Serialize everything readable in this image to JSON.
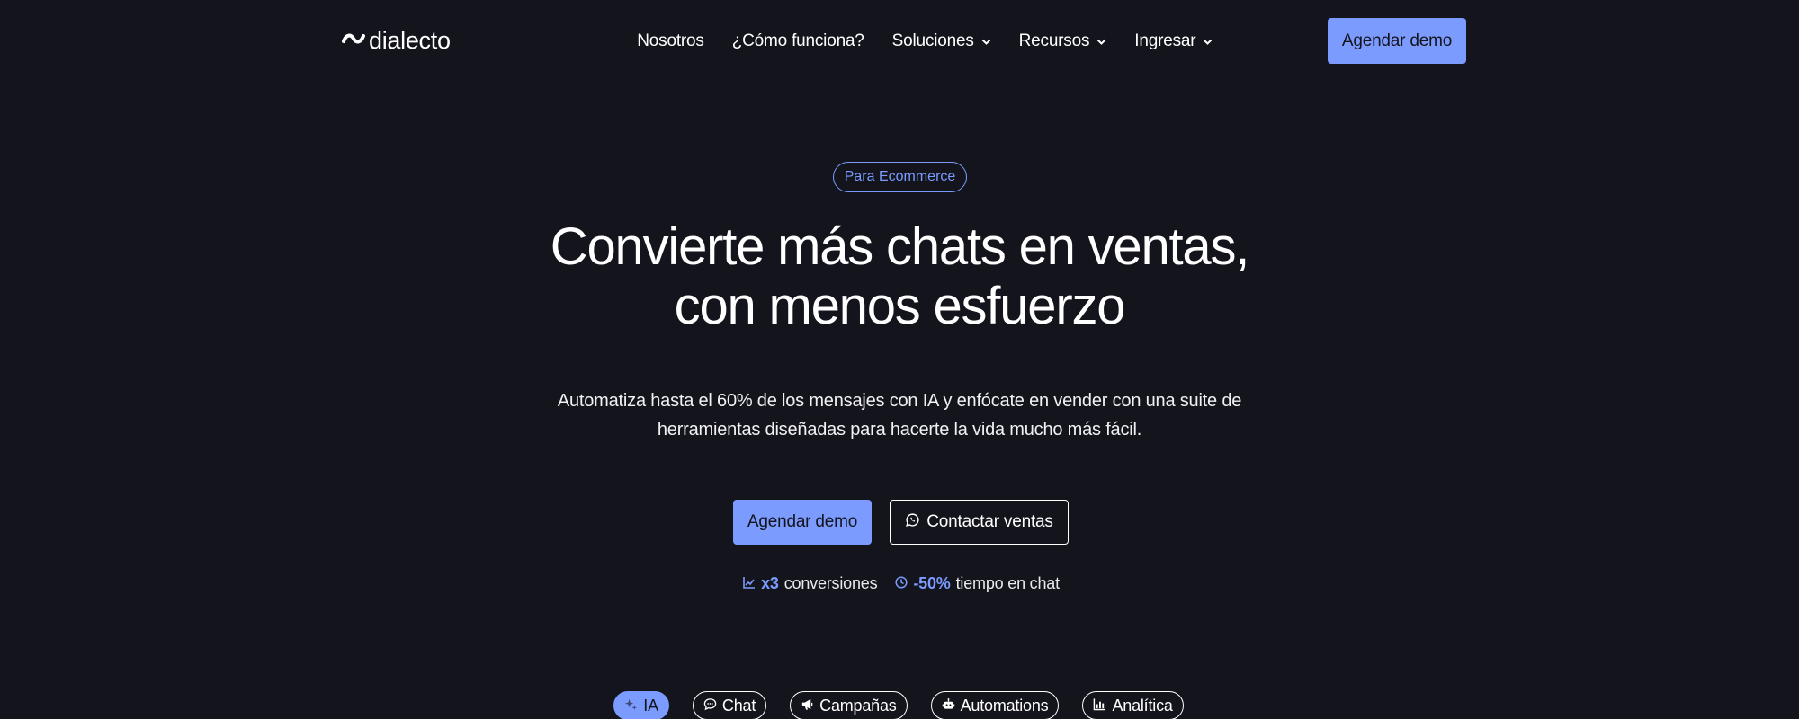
{
  "header": {
    "logo_text": "dialecto",
    "nav": [
      {
        "label": "Nosotros",
        "dropdown": false
      },
      {
        "label": "¿Cómo funciona?",
        "dropdown": false
      },
      {
        "label": "Soluciones",
        "dropdown": true
      },
      {
        "label": "Recursos",
        "dropdown": true
      },
      {
        "label": "Ingresar",
        "dropdown": true
      }
    ],
    "cta_label": "Agendar demo"
  },
  "hero": {
    "badge": "Para Ecommerce",
    "title_line1": "Convierte más chats en ventas,",
    "title_line2": "con menos esfuerzo",
    "subtitle_line1": "Automatiza hasta el 60% de los mensajes con IA y enfócate en vender con una suite de",
    "subtitle_line2": "herramientas diseñadas para hacerte la vida mucho más fácil.",
    "primary_cta": "Agendar demo",
    "secondary_cta": "Contactar ventas",
    "stats": [
      {
        "value": "x3",
        "label": "conversiones",
        "icon": "chart-line-icon"
      },
      {
        "value": "-50%",
        "label": "tiempo en chat",
        "icon": "clock-icon"
      }
    ]
  },
  "features": {
    "pills": [
      {
        "label": "IA",
        "icon": "sparkles-icon",
        "active": true
      },
      {
        "label": "Chat",
        "icon": "chat-bubble-icon",
        "active": false
      },
      {
        "label": "Campañas",
        "icon": "megaphone-icon",
        "active": false
      },
      {
        "label": "Automations",
        "icon": "robot-icon",
        "active": false
      },
      {
        "label": "Analítica",
        "icon": "bar-chart-icon",
        "active": false
      }
    ]
  },
  "colors": {
    "background": "#14141d",
    "accent": "#7b9bff",
    "text": "#ffffff"
  }
}
